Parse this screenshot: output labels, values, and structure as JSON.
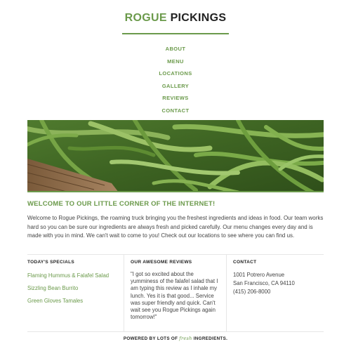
{
  "brand": {
    "first": "ROGUE",
    "second": "PICKINGS",
    "accent_color": "#6b9a4b"
  },
  "nav": {
    "items": [
      {
        "label": "ABOUT"
      },
      {
        "label": "MENU"
      },
      {
        "label": "LOCATIONS"
      },
      {
        "label": "GALLERY"
      },
      {
        "label": "REVIEWS"
      },
      {
        "label": "CONTACT"
      }
    ]
  },
  "hero": {
    "image": "green-beans-photo"
  },
  "intro": {
    "heading": "WELCOME TO OUR LITTLE CORNER OF THE INTERNET!",
    "body": "Welcome to Rogue Pickings, the roaming truck bringing you the freshest ingredients and ideas in food. Our team works hard so you can be sure our ingredients are always fresh and picked carefully. Our menu changes every day and is made with you in mind. We can't wait to come to you! Check out our locations to see where you can find us."
  },
  "specials": {
    "title": "TODAY'S SPECIALS",
    "items": [
      "Flaming Hummus & Falafel Salad",
      "Sizzling Bean Burrito",
      "Green Gloves Tamales"
    ]
  },
  "reviews": {
    "title": "OUR AWESOME REVIEWS",
    "quote": "\"I got so excited about the yumminess of the falafel salad that I am typing this review as I inhale my lunch. Yes it is that good... Service was super friendly and quick. Can't wait see you Rogue Pickings again tomorrow!\""
  },
  "contact": {
    "title": "CONTACT",
    "street": "1001 Potrero Avenue",
    "city": "San Francisco, CA 94110",
    "phone": "(415) 206-8000"
  },
  "footer": {
    "prefix": "POWERED BY LOTS OF",
    "fresh": "fresh",
    "suffix": "INGREDIENTS."
  }
}
